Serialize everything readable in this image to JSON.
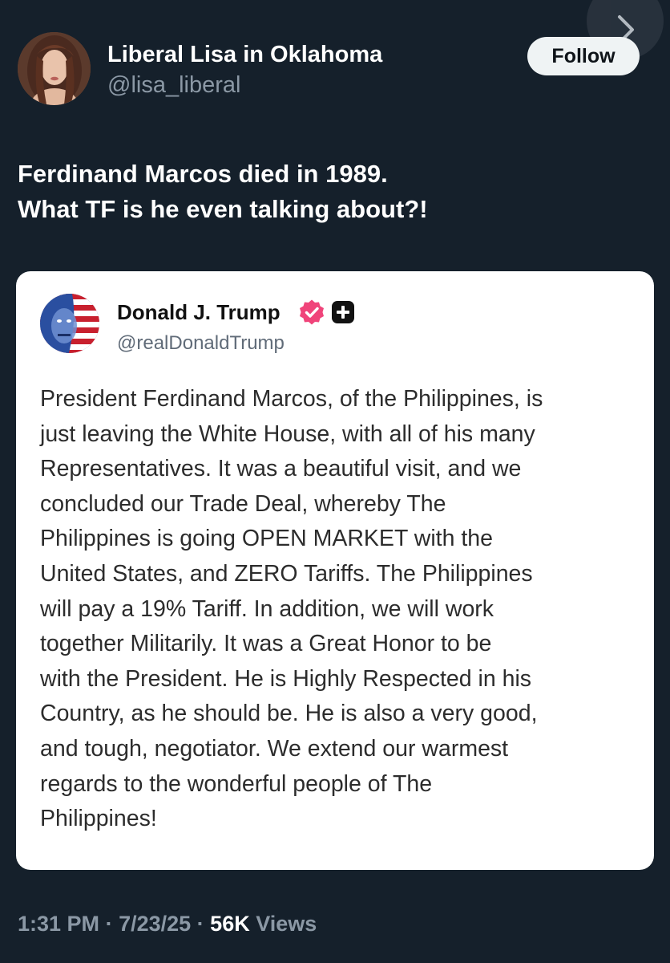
{
  "post": {
    "author_name": "Liberal Lisa in Oklahoma",
    "author_handle": "@lisa_liberal",
    "follow_label": "Follow",
    "text_lines": [
      "Ferdinand Marcos died in 1989.",
      "What TF is he even talking about?!"
    ],
    "time": "1:31 PM",
    "date": "7/23/25",
    "views_count": "56K",
    "views_label": "Views"
  },
  "quote": {
    "author_name": "Donald J. Trump",
    "author_handle": "@realDonaldTrump",
    "body_lines": [
      "President Ferdinand Marcos, of the Philippines, is",
      "just leaving the White House, with all of his many",
      "Representatives. It was a beautiful visit, and we",
      "concluded our Trade Deal, whereby The",
      "Philippines is going OPEN MARKET with the",
      "United States, and ZERO Tariffs. The Philippines",
      "will pay a 19% Tariff. In addition, we will work",
      "together Militarily. It was a Great Honor to be",
      "with the President. He is Highly Respected in his",
      "Country, as he should be. He is also a very good,",
      "and tough, negotiator. We extend our warmest",
      "regards to the wonderful people of The",
      "Philippines!"
    ]
  },
  "icons": {
    "nav": "chevron-right-icon",
    "verified": "verified-badge-icon",
    "plus": "plus-icon"
  },
  "colors": {
    "background": "#15202b",
    "muted_text": "#8b98a5",
    "verified_badge": "#f0447a",
    "follow_button": "#eff3f4"
  }
}
